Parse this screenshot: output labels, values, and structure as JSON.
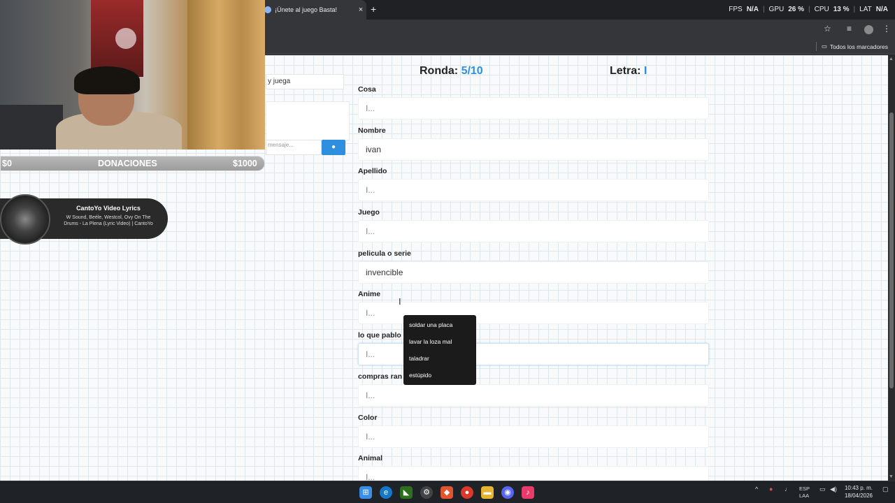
{
  "browser": {
    "tab_title": "¡Únete al juego Basta!",
    "tab_close": "×",
    "new_tab": "+",
    "bookmarks_all": "Todos los marcadores"
  },
  "stats": {
    "fps_label": "FPS",
    "fps_value": "N/A",
    "gpu_label": "GPU",
    "gpu_value": "26 %",
    "cpu_label": "CPU",
    "cpu_value": "13 %",
    "lat_label": "LAT",
    "lat_value": "N/A"
  },
  "left_panel": {
    "input_text": "y juega",
    "message_placeholder": "mensaje..."
  },
  "game": {
    "ronda_label": "Ronda:",
    "ronda_value": "5/10",
    "letra_label": "Letra:",
    "letra_value": "I"
  },
  "fields": [
    {
      "label": "Cosa",
      "value": "",
      "placeholder": "I..."
    },
    {
      "label": "Nombre",
      "value": "ivan",
      "placeholder": "I..."
    },
    {
      "label": "Apellido",
      "value": "",
      "placeholder": "I..."
    },
    {
      "label": "Juego",
      "value": "",
      "placeholder": "I..."
    },
    {
      "label": "pelicula o serie",
      "value": "invencible",
      "placeholder": "I..."
    },
    {
      "label": "Anime",
      "value": "",
      "placeholder": "I..."
    },
    {
      "label": "lo que pablo podria llegar ser",
      "value": "",
      "placeholder": "I..."
    },
    {
      "label": "compras ran",
      "value": "",
      "placeholder": "I..."
    },
    {
      "label": "Color",
      "value": "",
      "placeholder": "I..."
    },
    {
      "label": "Animal",
      "value": "",
      "placeholder": "I..."
    }
  ],
  "suggestions": [
    "soldar una placa",
    "lavar la loza mal",
    "taladrar",
    "estúpido"
  ],
  "overlay": {
    "donation_min": "$0",
    "donation_label": "DONACIONES",
    "donation_max": "$1000",
    "music_title": "CantoYo Video Lyrics",
    "music_subtitle": "W Sound, Beéle, Westcol, Ovy On The Drums - La Plena (Lyric Video) | CantoYo"
  },
  "taskbar": {
    "lang": "ESP",
    "lang2": "LAA",
    "time": "10:43 p. m.",
    "date": "18/04/2026",
    "caret": "^"
  },
  "colors": {
    "accent": "#2f8fdf",
    "page_bg": "#f8fafb",
    "dropdown_bg": "#1b1b1b"
  }
}
